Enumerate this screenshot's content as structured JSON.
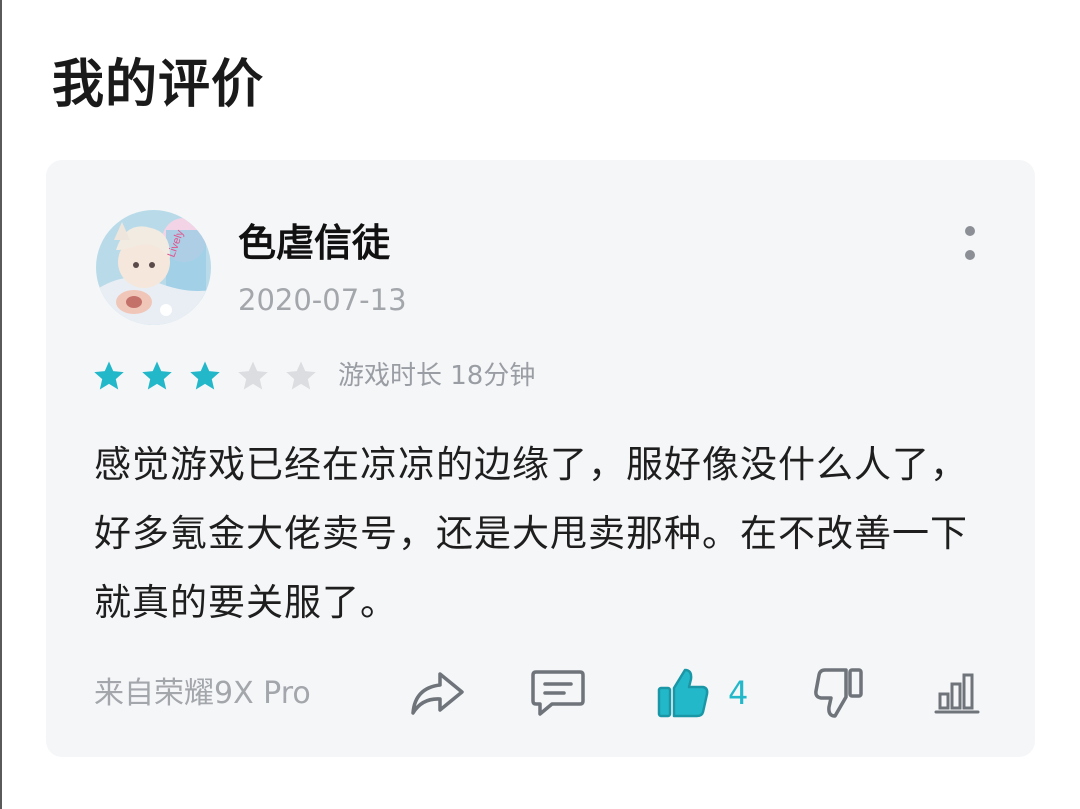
{
  "page": {
    "title": "我的评价"
  },
  "review": {
    "username": "色虐信徒",
    "date": "2020-07-13",
    "rating": 3,
    "max_rating": 5,
    "playtime": "游戏时长 18分钟",
    "text": "感觉游戏已经在凉凉的边缘了，服好像没什么人了，好多氪金大佬卖号，还是大甩卖那种。在不改善一下就真的要关服了。",
    "device": "来自荣耀9X Pro",
    "likes": "4"
  },
  "colors": {
    "accent": "#23b8c9",
    "star_off": "#dcdde0",
    "icon": "#6f747b",
    "card_bg": "#f5f6f8"
  },
  "icons": [
    "more-vertical-icon",
    "star-icon",
    "share-icon",
    "comment-icon",
    "thumbs-up-icon",
    "thumbs-down-icon",
    "stats-icon"
  ]
}
